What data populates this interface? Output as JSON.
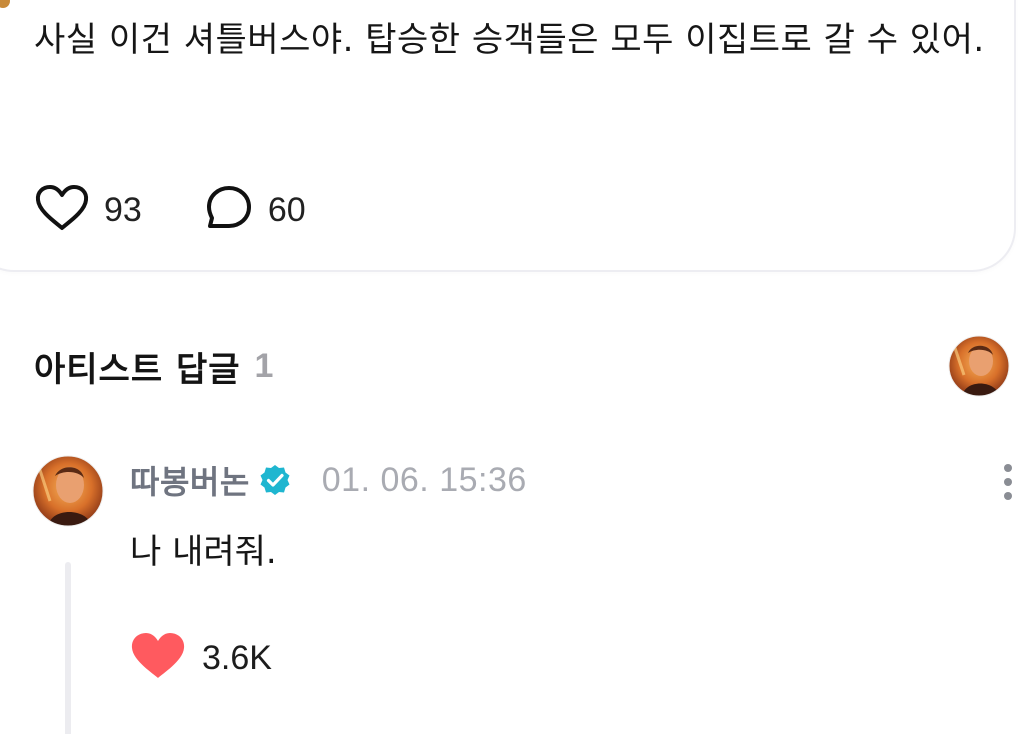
{
  "post": {
    "text": "사실 이건 셔틀버스야. 탑승한 승객들은 모두 이집트로 갈 수 있어.",
    "like_count": "93",
    "comment_count": "60"
  },
  "section": {
    "title": "아티스트 답글",
    "count": "1"
  },
  "reply": {
    "author": "따봉버논",
    "timestamp": "01. 06. 15:36",
    "text": "나 내려줘.",
    "like_count": "3.6K"
  },
  "colors": {
    "liked_heart": "#ff5a5f",
    "verified_badge": "#1fb6d0",
    "muted_text": "#a9abb2"
  },
  "icons": {
    "like": "heart-outline-icon",
    "comment": "speech-bubble-icon",
    "verified": "verified-badge-icon",
    "more": "more-vertical-icon",
    "reply_like": "heart-filled-icon"
  }
}
